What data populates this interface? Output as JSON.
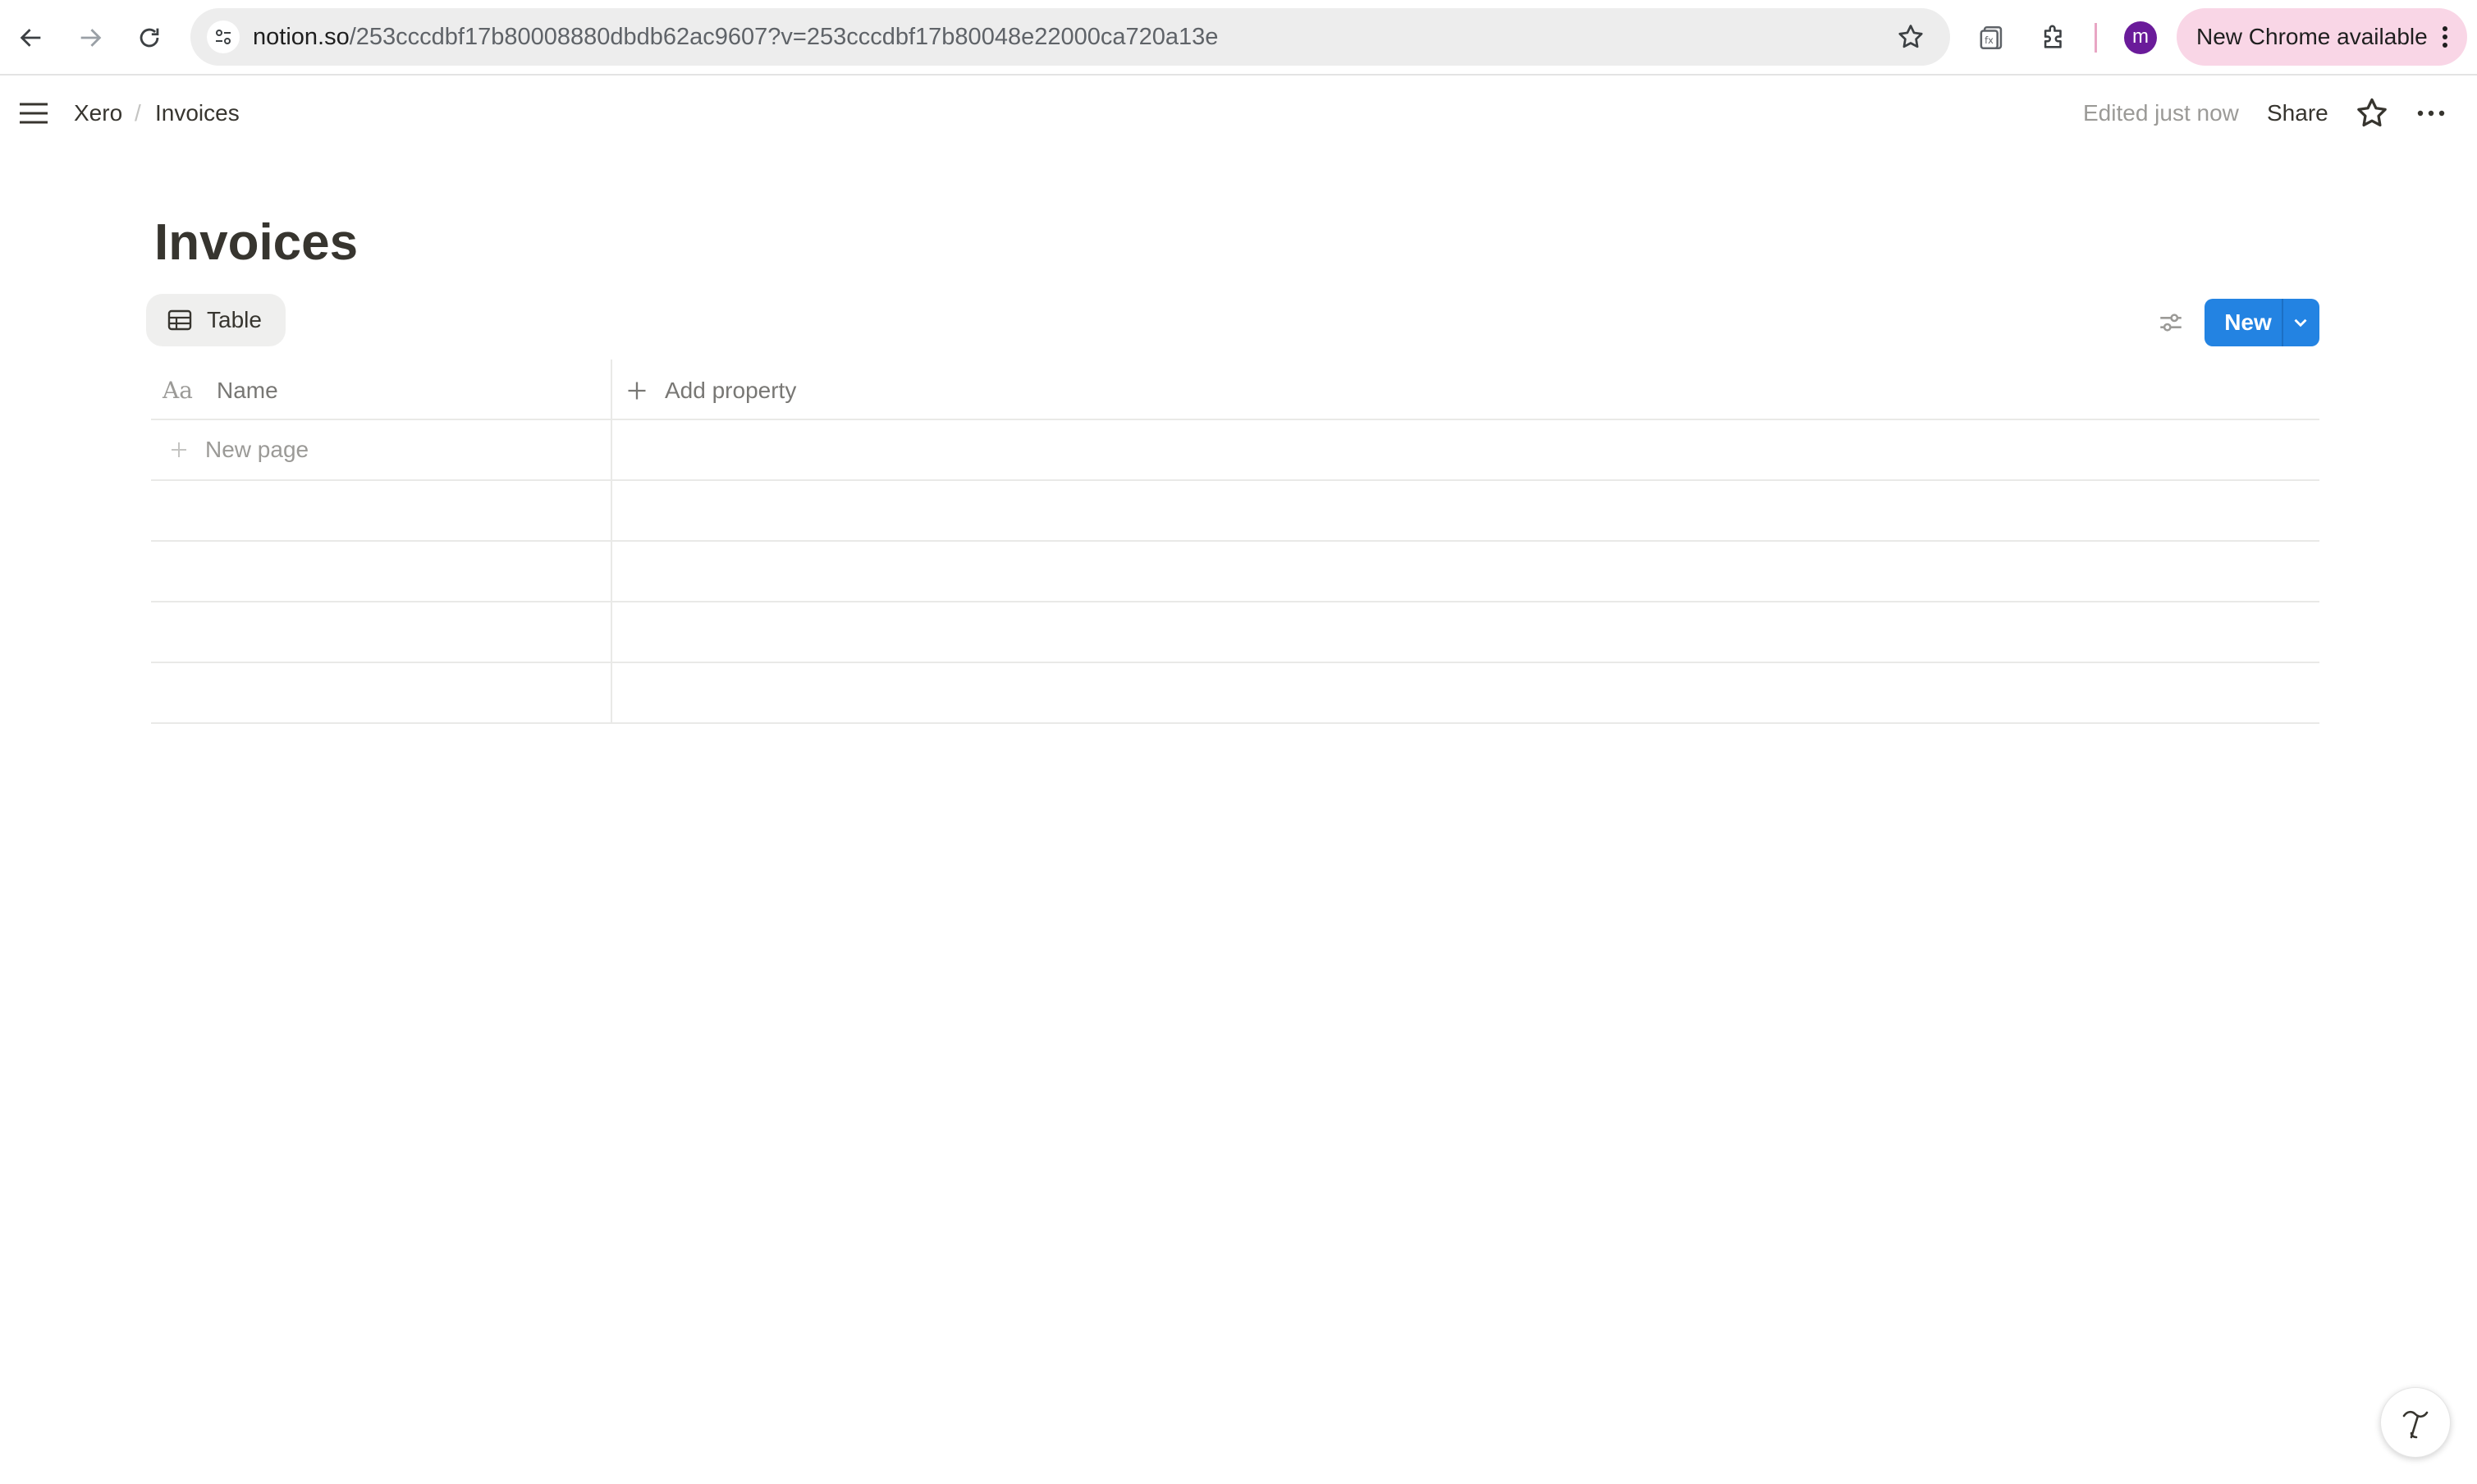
{
  "browser": {
    "url_host": "notion.so",
    "url_path": "/253cccdbf17b80008880dbdb62ac9607?v=253cccdbf17b80048e22000ca720a13e",
    "profile_initial": "m",
    "update_label": "New Chrome available",
    "colors": {
      "avatar": "#6a1b9a",
      "update_pill": "#f9d6e6"
    }
  },
  "topbar": {
    "breadcrumb": [
      "Xero",
      "Invoices"
    ],
    "separator": "/",
    "edited_status": "Edited just now",
    "share_label": "Share"
  },
  "page": {
    "title": "Invoices",
    "view_tab_label": "Table",
    "new_button_label": "New",
    "accent_color": "#2383e2"
  },
  "table": {
    "columns": [
      {
        "icon": "Aa",
        "label": "Name"
      }
    ],
    "add_property_label": "Add property",
    "new_page_label": "New page",
    "empty_rows": 4
  },
  "icons": {
    "back": "arrow-left-icon",
    "forward": "arrow-right-icon",
    "reload": "reload-icon",
    "site_info": "tune-icon",
    "bookmark": "star-outline-icon",
    "extensions": [
      "formula-extension-icon",
      "puzzle-icon"
    ],
    "menu": "hamburger-icon",
    "favorite": "star-outline-icon",
    "more": "ellipsis-icon",
    "view": "table-icon",
    "settings": "sliders-icon",
    "help": "help-squiggle-icon"
  }
}
